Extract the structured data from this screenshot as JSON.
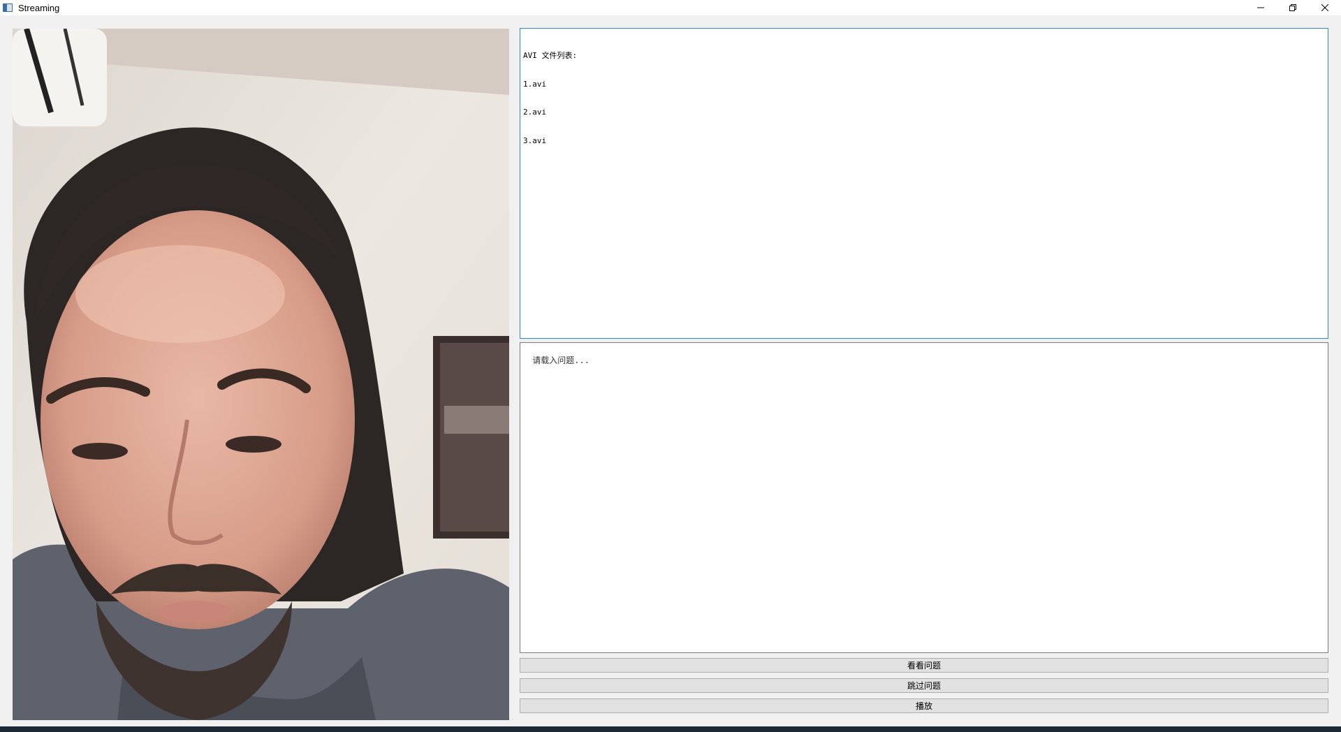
{
  "window": {
    "title": "Streaming",
    "controls": [
      "minimize-icon",
      "restore-icon",
      "close-icon"
    ]
  },
  "video": {
    "icon": "webcam-feed"
  },
  "file_list": {
    "header": "AVI 文件列表:",
    "items": [
      "1.avi",
      "2.avi",
      "3.avi"
    ]
  },
  "question_input": {
    "placeholder": "请载入问题..."
  },
  "buttons": {
    "view_question": "看看问题",
    "skip_question": "跳过问题",
    "play": "播放"
  },
  "colors": {
    "focus_border": "#2b8ad8",
    "button_bg": "#e1e1e1",
    "window_bg": "#f0f0f0"
  }
}
